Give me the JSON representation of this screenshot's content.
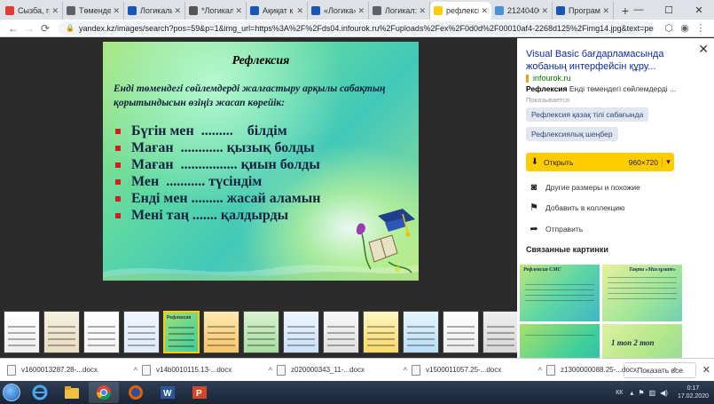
{
  "browser": {
    "tabs": [
      {
        "label": "Сызба, гр",
        "icon": "yandex-icon",
        "color": "#e53935"
      },
      {
        "label": "Төмендегі",
        "icon": "chrome-icon",
        "color": "#5f6368"
      },
      {
        "label": "Логикалы",
        "icon": "bookmark-icon",
        "color": "#1a56b5"
      },
      {
        "label": "*Логикал",
        "icon": "file-icon",
        "color": "#555555"
      },
      {
        "label": "Ақиқат к",
        "icon": "bookmark-icon",
        "color": "#1a56b5"
      },
      {
        "label": "«Логика»",
        "icon": "bookmark-icon",
        "color": "#1a56b5"
      },
      {
        "label": "Логикал:",
        "icon": "chrome-icon",
        "color": "#5f6368"
      },
      {
        "label": "рефлекси",
        "icon": "yandex-images-icon",
        "color": "#ffcc00"
      },
      {
        "label": "21240400",
        "icon": "globe-icon",
        "color": "#4a90d9"
      },
      {
        "label": "Програм",
        "icon": "bookmark-icon",
        "color": "#1a56b5"
      }
    ],
    "active_tab_index": 7,
    "url": "yandex.kz/images/search?pos=59&p=1&img_url=https%3A%2F%2Fds04.infourok.ru%2Fuploads%2Fex%2F0d0d%2F00010af4-2268d125%2Fimg14.jpg&text=рефлексия...",
    "new_tab_symbol": "+",
    "window_controls": {
      "minimize": "—",
      "maximize": "☐",
      "close": "✕"
    }
  },
  "slide": {
    "title": "Рефлексия",
    "intro": "Енді төмендегі сөйлемдерді жалғастыру арқылы сабақтың қорытындысын өзіңіз жасап көрейік:",
    "bullets": [
      "Бүгін мен  .........    білдім",
      "Маған  ............ қызық болды",
      "Маған  ................ қиын болды",
      "Мен  ........... түсіндім",
      "Енді мен ......... жасай аламын",
      "Мені таң ....... қалдырды"
    ]
  },
  "thumbnails": {
    "count": 14,
    "selected_index": 4,
    "labels": [
      "",
      "",
      "",
      "",
      "Рефлексия",
      "",
      "",
      "",
      "",
      "",
      "",
      "",
      "",
      ""
    ]
  },
  "panel": {
    "title": "Visual Basic бағдарламасында жобаның интерфейсін құру...",
    "source": "infourok.ru",
    "desc_bold": "Рефлексия",
    "desc_rest": " Енді төмендегі сөйлемдерді ...",
    "show_more": "Показывается",
    "chips": [
      "Рефлексия қазақ тілі сабағында",
      "Рефлексиялық шеңбер"
    ],
    "open_label": "Открыть",
    "image_size": "960×720",
    "actions": [
      "Другие размеры и похожие",
      "Добавить в коллекцию",
      "Отправить"
    ],
    "related_title": "Связанные картинки",
    "related": [
      {
        "title": "Рефлексия СМС"
      },
      {
        "title": "Тақта «Мағлұмат»"
      },
      {
        "title": ""
      },
      {
        "title": "1 топ   2 топ"
      }
    ]
  },
  "downloads": {
    "items": [
      "v1600013287.28-...docx",
      "v14b0010115.13-...docx",
      "z020000343_11-...docx",
      "v1500011057.25-...docx",
      "z1300000088.25-...docx"
    ],
    "show_all": "Показать все"
  },
  "taskbar": {
    "lang": "КК",
    "time": "0:17",
    "date": "17.02.2020"
  },
  "colors": {
    "yandex_yellow": "#ffcc00",
    "link_blue": "#0c2ca1",
    "bullet_red": "#d21d1d"
  }
}
